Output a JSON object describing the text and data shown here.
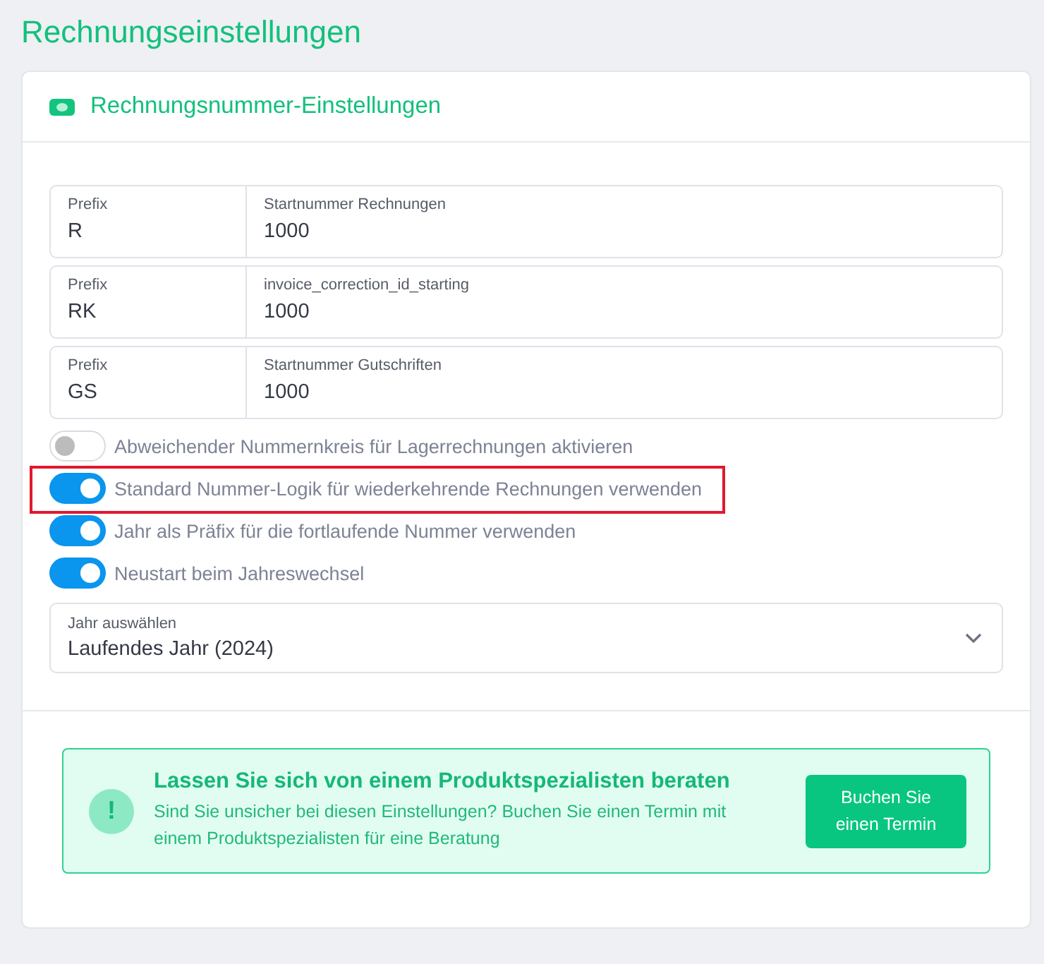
{
  "page_title": "Rechnungseinstellungen",
  "card": {
    "title": "Rechnungsnummer-Einstellungen"
  },
  "number_fields": [
    {
      "prefix_label": "Prefix",
      "prefix_value": "R",
      "start_label": "Startnummer Rechnungen",
      "start_value": "1000"
    },
    {
      "prefix_label": "Prefix",
      "prefix_value": "RK",
      "start_label": "invoice_correction_id_starting",
      "start_value": "1000"
    },
    {
      "prefix_label": "Prefix",
      "prefix_value": "GS",
      "start_label": "Startnummer Gutschriften",
      "start_value": "1000"
    }
  ],
  "toggles": [
    {
      "label": "Abweichender Nummernkreis für Lagerrechnungen aktivieren",
      "on": false,
      "highlighted": false
    },
    {
      "label": "Standard Nummer-Logik für wiederkehrende Rechnungen verwenden",
      "on": true,
      "highlighted": true
    },
    {
      "label": "Jahr als Präfix für die fortlaufende Nummer verwenden",
      "on": true,
      "highlighted": false
    },
    {
      "label": "Neustart beim Jahreswechsel",
      "on": true,
      "highlighted": false
    }
  ],
  "year_select": {
    "label": "Jahr auswählen",
    "value": "Laufendes Jahr (2024)"
  },
  "banner": {
    "icon": "!",
    "title": "Lassen Sie sich von einem Produktspezialisten beraten",
    "text": "Sind Sie unsicher bei diesen Einstellungen? Buchen Sie einen Termin mit einem Produktspezialisten für eine Beratung",
    "button": "Buchen Sie einen Termin"
  }
}
